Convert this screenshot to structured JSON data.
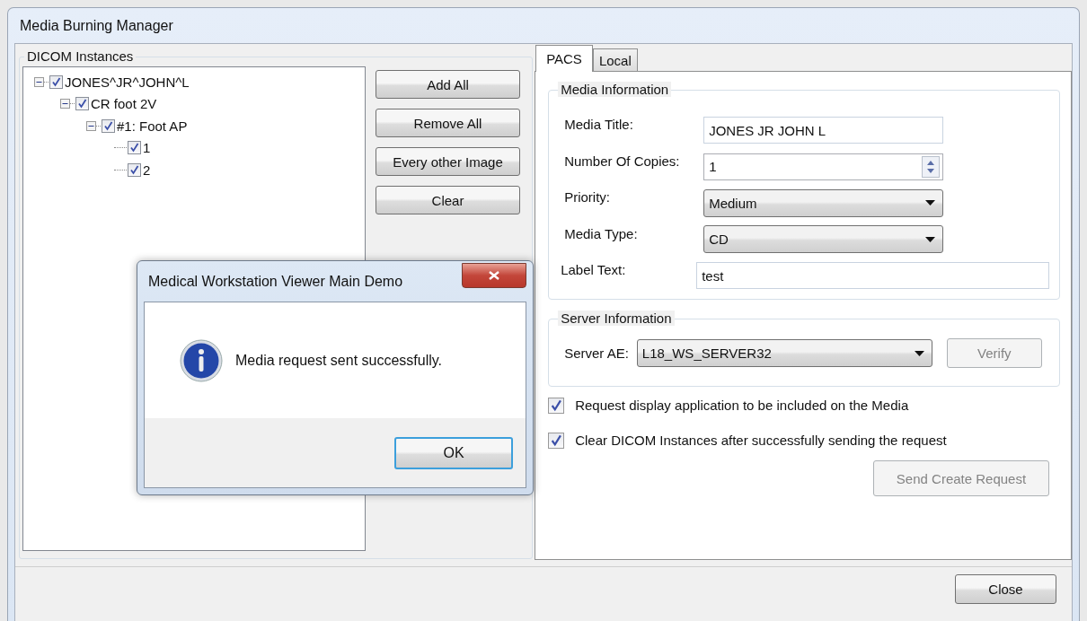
{
  "window": {
    "title": "Media Burning Manager"
  },
  "dicom_instances": {
    "title": "DICOM Instances",
    "tree": [
      {
        "label": "JONES^JR^JOHN^L",
        "checked": true,
        "expanded": true,
        "children": [
          {
            "label": "CR foot 2V",
            "checked": true,
            "expanded": true,
            "children": [
              {
                "label": "#1: Foot AP",
                "checked": true,
                "expanded": true,
                "children": [
                  {
                    "label": "1",
                    "checked": true
                  },
                  {
                    "label": "2",
                    "checked": true
                  }
                ]
              }
            ]
          }
        ]
      }
    ]
  },
  "action_buttons": [
    "Add All",
    "Remove All",
    "Every other Image",
    "Clear"
  ],
  "tabs": [
    {
      "label": "PACS",
      "selected": true
    },
    {
      "label": "Local",
      "selected": false
    }
  ],
  "media_information": {
    "title": "Media Information",
    "fields": [
      {
        "label": "Media Title:",
        "kind": "text",
        "value": "JONES JR JOHN L"
      },
      {
        "label": "Number Of Copies:",
        "kind": "spinner",
        "value": "1"
      },
      {
        "label": "Priority:",
        "kind": "dropdown",
        "value": "Medium"
      },
      {
        "label": "Media Type:",
        "kind": "dropdown",
        "value": "CD"
      },
      {
        "label": "Label Text:",
        "kind": "wide_text",
        "value": "test"
      }
    ]
  },
  "server_information": {
    "title": "Server Information",
    "label": "Server AE:",
    "value": "L18_WS_SERVER32",
    "verify_button": {
      "label": "Verify",
      "disabled": true
    }
  },
  "options": [
    {
      "label": "Request display application to be included on the Media",
      "checked": true
    },
    {
      "label": "Clear DICOM Instances after successfully sending the request",
      "checked": true
    }
  ],
  "send_button": {
    "label": "Send Create Request",
    "disabled": true
  },
  "close_button": "Close",
  "message_box": {
    "title": "Medical Workstation Viewer Main Demo",
    "message": "Media request sent successfully.",
    "ok_button": "OK"
  }
}
